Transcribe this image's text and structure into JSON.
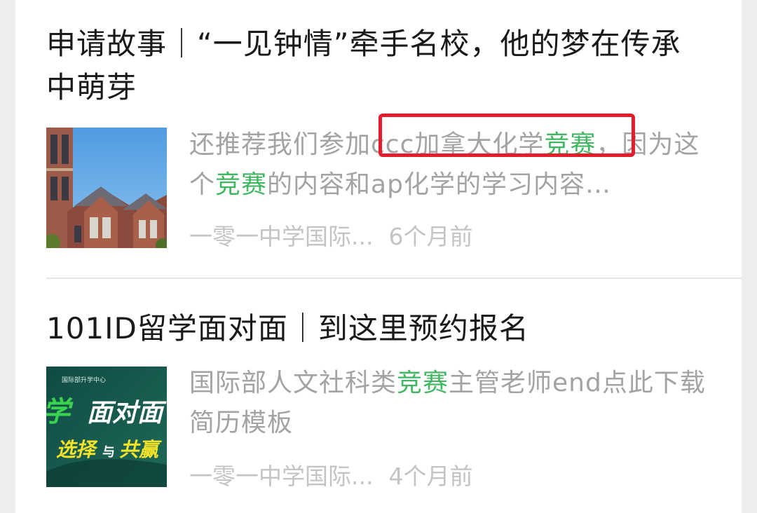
{
  "articles": [
    {
      "title": "申请故事｜“一见钟情”牵手名校，他的梦在传承中萌芽",
      "snippet_parts": [
        "还推荐我们参加ccc加拿大化学",
        "竞赛",
        "，因为这个",
        "竞赛",
        "的内容和ap化学的学习内容…"
      ],
      "source": "一零一中学国际...",
      "time": "6个月前",
      "thumbnail": "campus-building-photo"
    },
    {
      "title": "101ID留学面对面｜到这里预约报名",
      "snippet_parts": [
        "国际部人文社科类",
        "竞赛",
        "主管老师end点此下载简历模板"
      ],
      "source": "一零一中学国际...",
      "time": "4个月前",
      "thumbnail": {
        "top_text": "国际部升学中心",
        "big_text_1": "学",
        "big_text_2": "面对面",
        "sub_text_1": "选择",
        "sub_text_2": "与",
        "sub_text_3": "共赢"
      }
    }
  ],
  "colors": {
    "keyword": "#3fb760",
    "highlight_box": "#e31d2b",
    "title": "#1a1a1a",
    "snippet": "#a3a3a3",
    "meta": "#c4c4c4"
  }
}
